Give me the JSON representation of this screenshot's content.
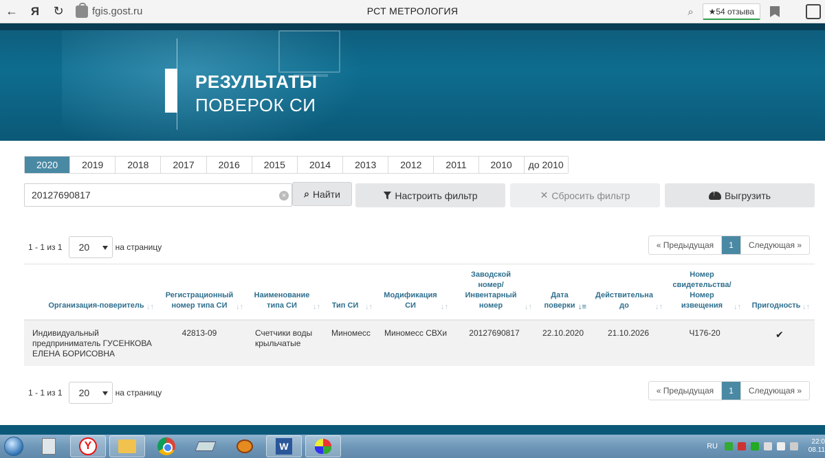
{
  "browser": {
    "domain": "fgis.gost.ru",
    "title": "РСТ МЕТРОЛОГИЯ",
    "reviews_label": "★54 отзыва",
    "back_icon": "back-arrow-icon",
    "ya_label": "Я"
  },
  "hero": {
    "title_line1": "РЕЗУЛЬТАТЫ",
    "title_line2": "ПОВЕРОК СИ"
  },
  "years": [
    "2020",
    "2019",
    "2018",
    "2017",
    "2016",
    "2015",
    "2014",
    "2013",
    "2012",
    "2011",
    "2010",
    "до 2010"
  ],
  "active_year": "2020",
  "search": {
    "value": "20127690817",
    "find_label": "Найти",
    "filter_label": "Настроить фильтр",
    "reset_label": "Сбросить фильтр",
    "export_label": "Выгрузить"
  },
  "pagination": {
    "range": "1 - 1 из 1",
    "per_page": "20",
    "per_page_suffix": "на страницу",
    "prev": "« Предыдущая",
    "current": "1",
    "next": "Следующая »"
  },
  "table": {
    "headers": [
      "Организация-поверитель",
      "Регистрационный номер типа СИ",
      "Наименование типа СИ",
      "Тип СИ",
      "Модификация СИ",
      "Заводской номер/ Инвентарный номер",
      "Дата поверки",
      "Действительна до",
      "Номер свидетельства/ Номер извещения",
      "Пригодность"
    ],
    "rows": [
      {
        "org": "Индивидуальный предприниматель ГУСЕНКОВА ЕЛЕНА БОРИСОВНА",
        "reg_number": "42813-09",
        "type_name": "Счетчики воды крыльчатые",
        "type": "Миномесс",
        "modification": "Миномесс СВХи",
        "serial": "20127690817",
        "date": "22.10.2020",
        "valid_until": "21.10.2026",
        "certificate": "Ч176-20",
        "suitable": "✔"
      }
    ]
  },
  "taskbar": {
    "lang": "RU",
    "time": "22:0",
    "date": "08.11"
  },
  "colors": {
    "accent": "#4a89a3",
    "hero": "#0e6d8f",
    "header_text": "#2e6f8e"
  }
}
